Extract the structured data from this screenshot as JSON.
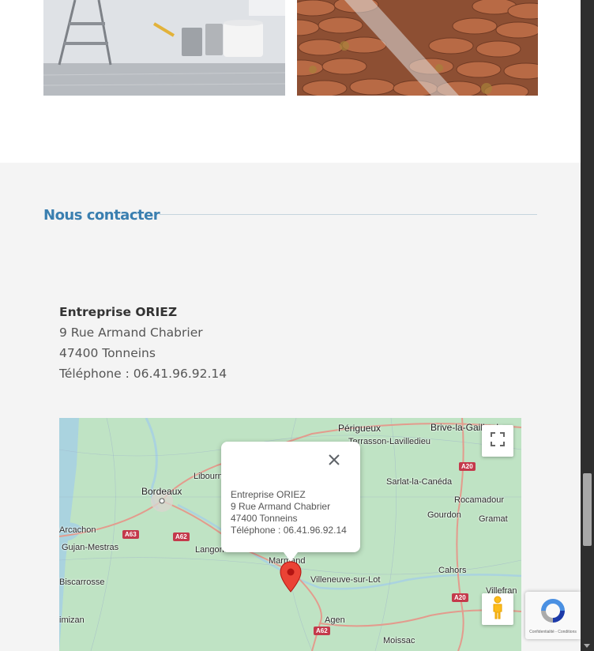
{
  "contact": {
    "title": "Nous contacter",
    "company": "Entreprise ORIEZ",
    "street": "9 Rue Armand Chabrier",
    "city": "47400 Tonneins",
    "phone": "Téléphone : 06.41.96.92.14"
  },
  "map": {
    "labels": {
      "perigueux": "Périgueux",
      "brive": "Brive-la-Gaillarde",
      "terrasson": "Terrasson-Lavilledieu",
      "bordeaux": "Bordeaux",
      "libourne": "Libourn",
      "sarlat": "Sarlat-la-Canéda",
      "rocamadour": "Rocamadour",
      "gourdon": "Gourdon",
      "gramat": "Gramat",
      "arcachon": "Arcachon",
      "gujan": "Gujan-Mestras",
      "langon": "Langon",
      "marmande": "Marmand",
      "biscarrosse": "Biscarrosse",
      "villeneuve": "Villeneuve-sur-Lot",
      "cahors": "Cahors",
      "villefranche": "Villefran",
      "mimizan": "imizan",
      "agen": "Agen",
      "moissac": "Moissac"
    },
    "roads": {
      "a20_top": "A20",
      "a63": "A63",
      "a62_left": "A62",
      "a20_bottom": "A20",
      "a62_bottom": "A62"
    },
    "info_window": {
      "company": "Entreprise ORIEZ",
      "street": "9 Rue Armand Chabrier",
      "city": "47400 Tonneins",
      "phone": "Téléphone : 06.41.96.92.14"
    }
  },
  "recaptcha": {
    "footer": "Confidentialité - Conditions"
  },
  "icons": [
    "close-icon",
    "map-marker-icon",
    "fullscreen-icon",
    "pegman-icon",
    "recaptcha-logo-icon"
  ],
  "colors": {
    "title": "#3a7fb0",
    "marker": "#ea4335",
    "road": "#c4394b",
    "map_land": "#c3e6c8"
  }
}
